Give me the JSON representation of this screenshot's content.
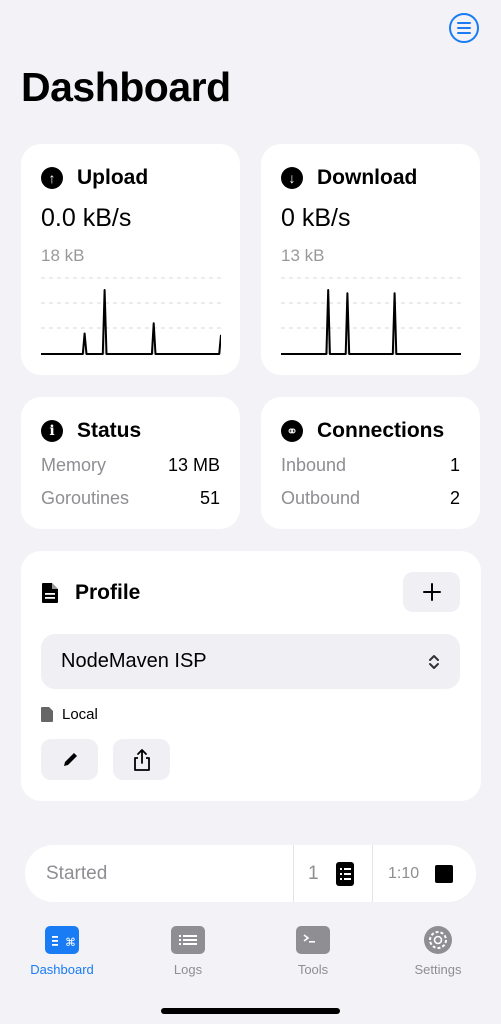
{
  "header": {
    "title": "Dashboard",
    "menu_icon": "menu-icon"
  },
  "upload": {
    "label": "Upload",
    "rate": "0.0 kB/s",
    "total": "18 kB",
    "icon": "arrow-up-circle-icon",
    "spark": [
      0,
      0,
      0,
      0,
      0,
      0,
      0,
      0,
      0,
      0,
      0,
      0,
      0,
      0,
      0,
      0,
      0,
      0,
      0,
      0,
      0,
      0,
      0,
      0,
      0.32,
      0,
      0,
      0,
      0,
      0,
      0,
      0,
      0,
      0,
      0,
      1,
      0,
      0,
      0,
      0,
      0,
      0,
      0,
      0,
      0,
      0,
      0,
      0,
      0,
      0,
      0,
      0,
      0,
      0,
      0,
      0,
      0,
      0,
      0,
      0,
      0,
      0,
      0.48,
      0,
      0,
      0,
      0,
      0,
      0,
      0,
      0,
      0,
      0,
      0,
      0,
      0,
      0,
      0,
      0,
      0,
      0,
      0,
      0,
      0,
      0,
      0,
      0,
      0,
      0,
      0,
      0,
      0,
      0,
      0,
      0,
      0,
      0,
      0,
      0,
      0.3
    ]
  },
  "download": {
    "label": "Download",
    "rate": "0 kB/s",
    "total": "13 kB",
    "icon": "arrow-down-circle-icon",
    "spark": [
      0,
      0,
      0,
      0,
      0,
      0,
      0,
      0,
      0,
      0,
      0,
      0,
      0,
      0,
      0,
      0,
      0,
      0,
      0,
      0,
      0,
      0,
      0,
      0,
      0,
      0,
      0,
      1,
      0,
      0,
      0,
      0,
      0,
      0,
      0,
      0,
      0,
      0,
      0.95,
      0,
      0,
      0,
      0,
      0,
      0,
      0,
      0,
      0,
      0,
      0,
      0,
      0,
      0,
      0,
      0,
      0,
      0,
      0,
      0,
      0,
      0,
      0,
      0,
      0,
      0,
      0.95,
      0,
      0,
      0,
      0,
      0,
      0,
      0,
      0,
      0,
      0,
      0,
      0,
      0,
      0,
      0,
      0,
      0,
      0,
      0,
      0,
      0,
      0,
      0,
      0,
      0,
      0,
      0,
      0,
      0,
      0,
      0,
      0,
      0,
      0,
      0,
      0,
      0,
      0
    ]
  },
  "status": {
    "label": "Status",
    "icon": "info-circle-icon",
    "rows": [
      {
        "key": "Memory",
        "value": "13 MB"
      },
      {
        "key": "Goroutines",
        "value": "51"
      }
    ]
  },
  "connections": {
    "label": "Connections",
    "icon": "link-circle-icon",
    "rows": [
      {
        "key": "Inbound",
        "value": "1"
      },
      {
        "key": "Outbound",
        "value": "2"
      }
    ]
  },
  "profile": {
    "label": "Profile",
    "selected": "NodeMaven ISP",
    "source": "Local"
  },
  "statusbar": {
    "state": "Started",
    "count": "1",
    "time": "1:10"
  },
  "tabs": [
    {
      "label": "Dashboard",
      "icon": "dashboard-icon",
      "active": true
    },
    {
      "label": "Logs",
      "icon": "logs-icon",
      "active": false
    },
    {
      "label": "Tools",
      "icon": "terminal-icon",
      "active": false
    },
    {
      "label": "Settings",
      "icon": "gear-icon",
      "active": false
    }
  ],
  "colors": {
    "accent": "#1a7cf5",
    "background": "#f2f2f7",
    "card": "#ffffff",
    "muted": "#8e8e93"
  }
}
